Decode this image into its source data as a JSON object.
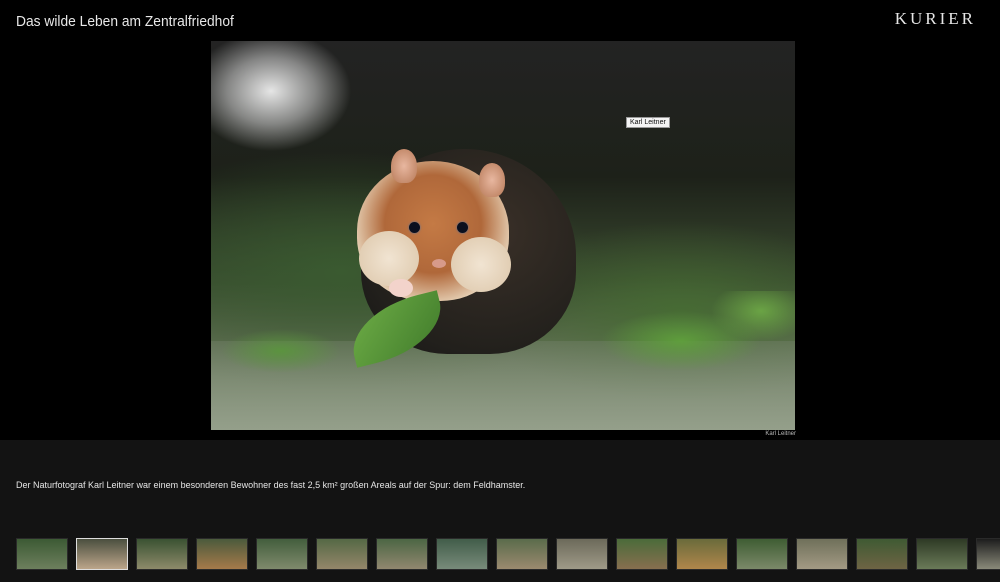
{
  "header": {
    "title": "Das wilde Leben am Zentralfriedhof",
    "logo": "KURIER"
  },
  "photo": {
    "tooltip": "Karl Leitner",
    "credit": "Karl Leitner"
  },
  "caption": "Der Naturfotograf Karl Leitner war einem besonderen Bewohner des fast 2,5 km² großen Areals auf der Spur: dem Feldhamster.",
  "thumbnails": [
    {
      "colors": [
        "#3c5a34",
        "#6d7f5d"
      ]
    },
    {
      "colors": [
        "#4a4f3f",
        "#bca58a"
      ],
      "selected": true
    },
    {
      "colors": [
        "#3a5232",
        "#8d8a6a"
      ]
    },
    {
      "colors": [
        "#4b5a3c",
        "#a67a4a"
      ]
    },
    {
      "colors": [
        "#435e3d",
        "#7f8a6c"
      ]
    },
    {
      "colors": [
        "#556845",
        "#94866a"
      ]
    },
    {
      "colors": [
        "#4c6644",
        "#91876f"
      ]
    },
    {
      "colors": [
        "#425d4a",
        "#788b7a"
      ]
    },
    {
      "colors": [
        "#5a6b4b",
        "#9b8a6f"
      ]
    },
    {
      "colors": [
        "#6c6a5a",
        "#9f9a88"
      ]
    },
    {
      "colors": [
        "#4b6b3a",
        "#876f4f"
      ]
    },
    {
      "colors": [
        "#6a6b3b",
        "#b0864b"
      ]
    },
    {
      "colors": [
        "#3f5d33",
        "#7b8969"
      ]
    },
    {
      "colors": [
        "#6f705a",
        "#a39a84"
      ]
    },
    {
      "colors": [
        "#3f5a33",
        "#6e6444"
      ]
    },
    {
      "colors": [
        "#2e3a25",
        "#6a7a58"
      ]
    },
    {
      "colors": [
        "#1d1d1d",
        "#8a8a7a"
      ]
    }
  ]
}
